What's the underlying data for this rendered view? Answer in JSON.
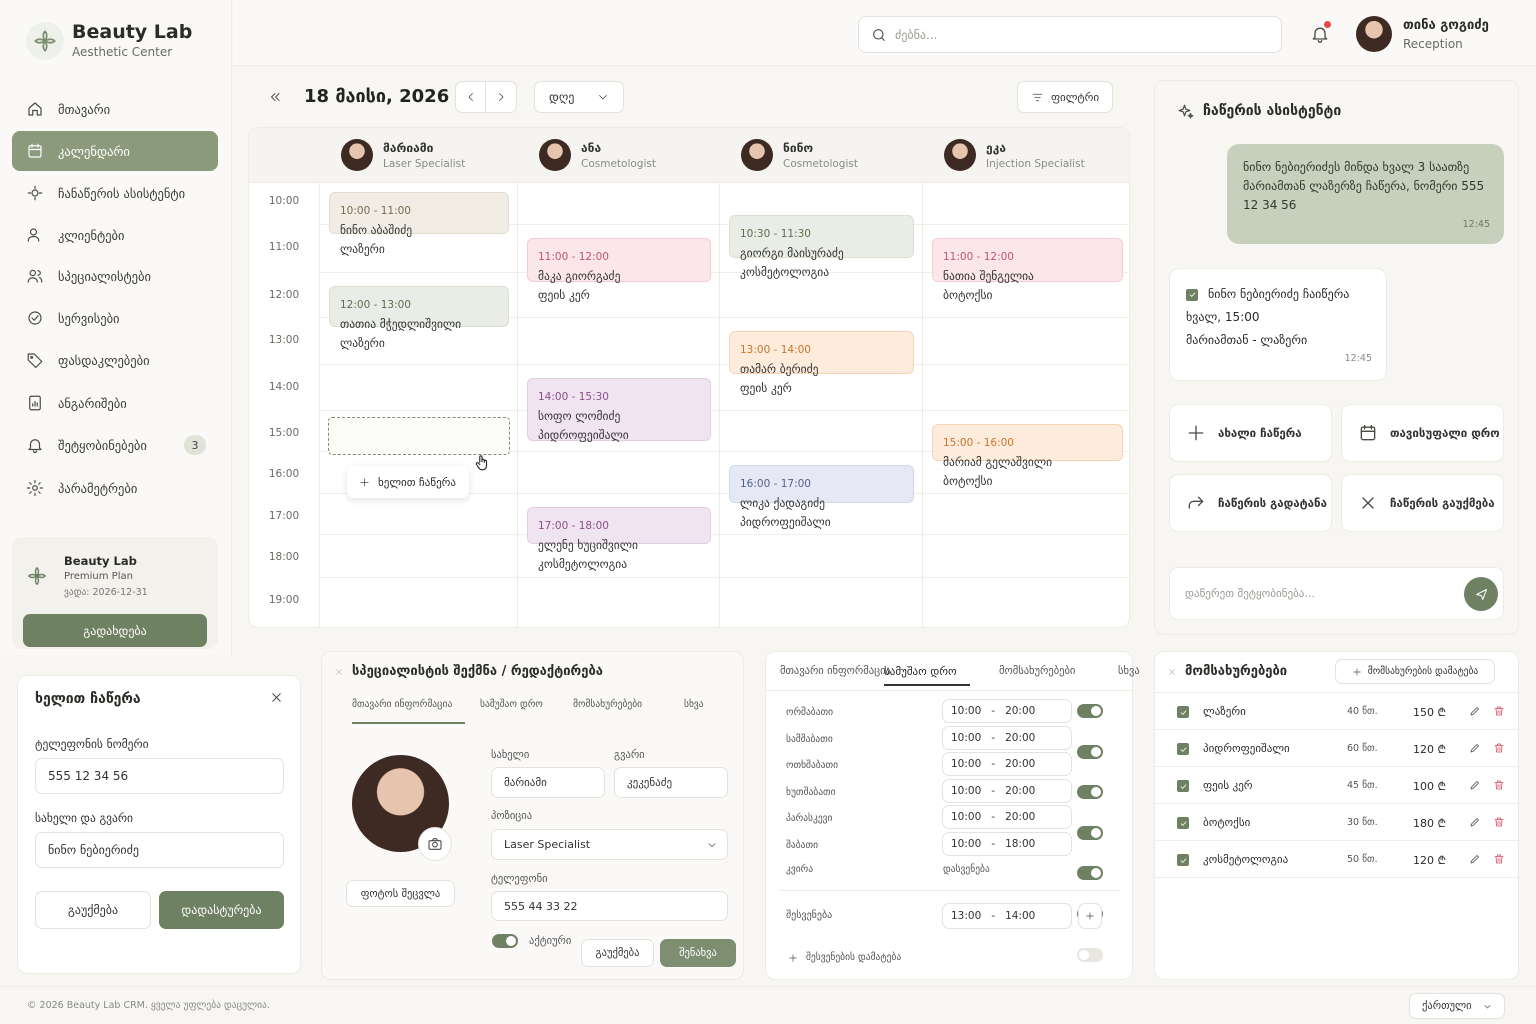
{
  "brand": {
    "name": "Beauty Lab",
    "subtitle": "Aesthetic Center"
  },
  "nav": [
    {
      "label": "მთავარი",
      "icon": "home-icon"
    },
    {
      "label": "კალენდარი",
      "icon": "calendar-icon",
      "active": true
    },
    {
      "label": "ჩანაწერის ასისტენტი",
      "icon": "assistant-icon"
    },
    {
      "label": "კლიენტები",
      "icon": "users-icon"
    },
    {
      "label": "სპეციალისტები",
      "icon": "specialists-icon"
    },
    {
      "label": "სერვისები",
      "icon": "services-icon"
    },
    {
      "label": "ფასდაკლებები",
      "icon": "tag-icon"
    },
    {
      "label": "ანგარიშები",
      "icon": "report-icon"
    },
    {
      "label": "შეტყობინებები",
      "icon": "bell-icon",
      "badge": "3"
    },
    {
      "label": "პარამეტრები",
      "icon": "gear-icon"
    }
  ],
  "plan": {
    "name": "Beauty Lab",
    "plan": "Premium Plan",
    "expiry": "ვადა: 2026-12-31",
    "button": "გადახდება"
  },
  "topbar": {
    "search_placeholder": "ძებნა...",
    "user_name": "თინა გოგიძე",
    "user_role": "Reception"
  },
  "calendar": {
    "date": "18 მაისი, 2026",
    "view": "დღე",
    "filter": "ფილტრი",
    "specialists": [
      {
        "name": "მარიამი",
        "role": "Laser Specialist"
      },
      {
        "name": "ანა",
        "role": "Cosmetologist"
      },
      {
        "name": "ნინო",
        "role": "Cosmetologist"
      },
      {
        "name": "ეკა",
        "role": "Injection Specialist"
      }
    ],
    "times": [
      "10:00",
      "11:00",
      "12:00",
      "13:00",
      "14:00",
      "15:00",
      "16:00",
      "17:00",
      "18:00",
      "19:00"
    ],
    "appointments": [
      {
        "col": 0,
        "time": "10:00 - 11:00",
        "client": "ნინო აბაშიძე",
        "service": "ლაზერი",
        "bg": "#f1ede4",
        "bd": "#e4ddcf",
        "tc": "#7a6a50"
      },
      {
        "col": 0,
        "time": "12:00 - 13:00",
        "client": "თათია მჭედლიშვილი",
        "service": "ლაზერი",
        "bg": "#e9ede5",
        "bd": "#d9e0d2",
        "tc": "#5c6e50"
      },
      {
        "col": 1,
        "time": "11:00 - 12:00",
        "client": "მაკა გიორგაძე",
        "service": "ფეის კერ",
        "bg": "#fbe6ea",
        "bd": "#f2ccd4",
        "tc": "#c0566c"
      },
      {
        "col": 1,
        "time": "14:00 - 15:30",
        "client": "სოფო ლომიძე",
        "service": "პიდროფეიშალი",
        "bg": "#f1e4f1",
        "bd": "#e3cde3",
        "tc": "#8a4f8a"
      },
      {
        "col": 1,
        "time": "17:00 - 18:00",
        "client": "ელენე ხუციშვილი",
        "service": "კოსმეტოლოგია",
        "bg": "#f1e4f1",
        "bd": "#e3cde3",
        "tc": "#8a4f8a"
      },
      {
        "col": 2,
        "time": "10:30 - 11:30",
        "client": "გიორგი მაისურაძე",
        "service": "კოსმეტოლოგია",
        "bg": "#e9ede5",
        "bd": "#d9e0d2",
        "tc": "#5c6e50"
      },
      {
        "col": 2,
        "time": "13:00 - 14:00",
        "client": "თამარ ბერიძე",
        "service": "ფეის კერ",
        "bg": "#fdebdb",
        "bd": "#f5d5b8",
        "tc": "#c9772e"
      },
      {
        "col": 2,
        "time": "16:00 - 17:00",
        "client": "ლიკა ქადაგიძე",
        "service": "პიდროფეიშალი",
        "bg": "#e6e9f5",
        "bd": "#d0d6ec",
        "tc": "#55608a"
      },
      {
        "col": 3,
        "time": "11:00 - 12:00",
        "client": "ნათია შენგელია",
        "service": "ბოტოქსი",
        "bg": "#fbe6ea",
        "bd": "#f2ccd4",
        "tc": "#c0566c"
      },
      {
        "col": 3,
        "time": "15:00 - 16:00",
        "client": "მარიამ გელაშვილი",
        "service": "ბოტოქსი",
        "bg": "#fdebdb",
        "bd": "#f5d5b8",
        "tc": "#c9772e"
      }
    ],
    "manual_button": "ხელით ჩაწერა"
  },
  "assistant": {
    "title": "ჩაწერის ასისტენტი",
    "user_message": "ნინო ნებიერიძეს მინდა ხვალ 3 საათზე მარიამთან ლაზერზე ჩაწერა, ნომერი 555 12 34 56",
    "user_time": "12:45",
    "reply_line1": "ნინო ნებიერიძე ჩაიწერა",
    "reply_line2": "ხვალ, 15:00",
    "reply_line3": "მარიამთან - ლაზერი",
    "reply_time": "12:45",
    "actions": [
      "ახალი ჩაწერა",
      "თავისუფალი დრო",
      "ჩაწერის გადატანა",
      "ჩაწერის გაუქმება"
    ],
    "input_placeholder": "დაწერეთ შეტყობინება..."
  },
  "manual": {
    "title": "ხელით ჩაწერა",
    "phone_label": "ტელეფონის ნომერი",
    "phone_value": "555 12 34 56",
    "name_label": "სახელი და გვარი",
    "name_value": "ნინო ნებიერიძე",
    "cancel": "გაუქმება",
    "confirm": "დადასტურება"
  },
  "specialist_form": {
    "title": "სპეციალისტის შექმნა / რედაქტირება",
    "tabs": [
      "მთავარი ინფორმაცია",
      "სამუშაო დრო",
      "მომსახურებები",
      "სხვა"
    ],
    "change_photo": "ფოტოს შეცვლა",
    "first_label": "სახელი",
    "first_value": "მარიამი",
    "last_label": "გვარი",
    "last_value": "კეკენაძე",
    "position_label": "პოზიცია",
    "position_value": "Laser Specialist",
    "phone_label": "ტელეფონი",
    "phone_value": "555 44 33 22",
    "active_label": "აქტიური",
    "cancel": "გაუქმება",
    "save": "შენახვა"
  },
  "schedule": {
    "tabs": [
      "მთავარი ინფორმაცია",
      "სამუშაო დრო",
      "მომსახურებები",
      "სხვა"
    ],
    "days": [
      {
        "day": "ორშაბათი",
        "from": "10:00",
        "to": "20:00",
        "on": true
      },
      {
        "day": "სამშაბათი",
        "from": "10:00",
        "to": "20:00",
        "on": true
      },
      {
        "day": "ოთხშაბათი",
        "from": "10:00",
        "to": "20:00",
        "on": true
      },
      {
        "day": "ხუთშაბათი",
        "from": "10:00",
        "to": "20:00",
        "on": true
      },
      {
        "day": "პარასკევი",
        "from": "10:00",
        "to": "20:00",
        "on": true
      },
      {
        "day": "შაბათი",
        "from": "10:00",
        "to": "18:00",
        "on": true
      }
    ],
    "sunday": {
      "day": "კვირა",
      "status": "დასვენება"
    },
    "break_label": "შესვენება",
    "break_from": "13:00",
    "break_to": "14:00",
    "add_break": "შესვენების დამატება"
  },
  "services": {
    "title": "მომსახურებები",
    "add_button": "მომსახურების დამატება",
    "items": [
      {
        "name": "ლაზერი",
        "duration": "40 წთ.",
        "price": "150 ₾"
      },
      {
        "name": "პიდროფეიშალი",
        "duration": "60 წთ.",
        "price": "120 ₾"
      },
      {
        "name": "ფეის კერ",
        "duration": "45 წთ.",
        "price": "100 ₾"
      },
      {
        "name": "ბოტოქსი",
        "duration": "30 წთ.",
        "price": "180 ₾"
      },
      {
        "name": "კოსმეტოლოგია",
        "duration": "50 წთ.",
        "price": "120 ₾"
      }
    ]
  },
  "footer": {
    "copyright": "© 2026 Beauty Lab CRM. ყველა უფლება დაცულია.",
    "language": "ქართული"
  },
  "colors": {
    "accent": "#6f8163",
    "accent_light": "#8a9a7b",
    "danger": "#d9485f"
  }
}
